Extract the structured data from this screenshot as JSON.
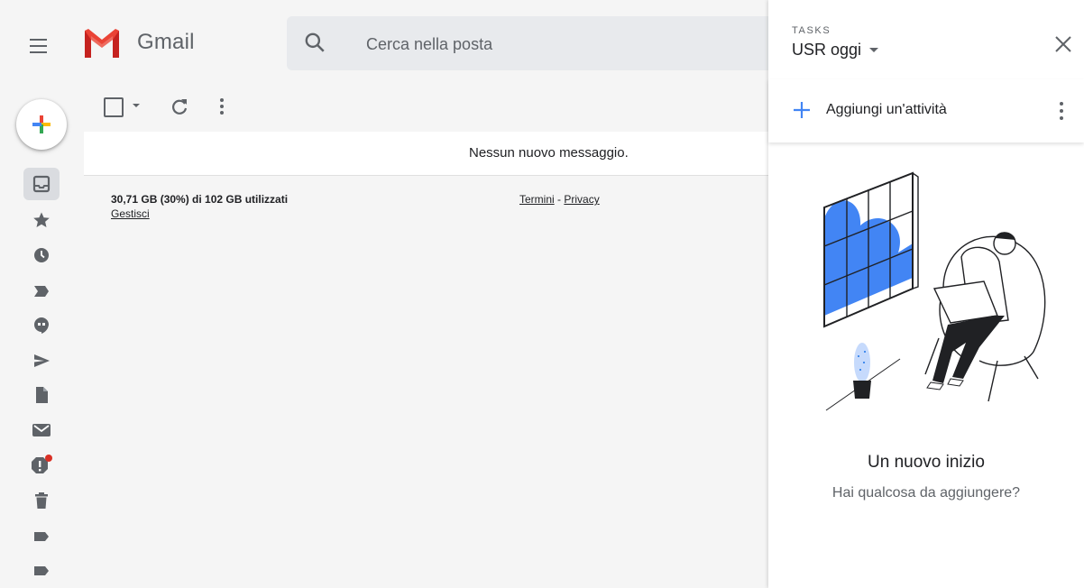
{
  "header": {
    "brand": "Gmail",
    "search_placeholder": "Cerca nella posta"
  },
  "nav": {
    "items": [
      {
        "name": "inbox-icon",
        "active": true
      },
      {
        "name": "star-icon"
      },
      {
        "name": "clock-icon"
      },
      {
        "name": "important-icon"
      },
      {
        "name": "chat-icon"
      },
      {
        "name": "send-icon"
      },
      {
        "name": "draft-icon"
      },
      {
        "name": "mail-icon"
      },
      {
        "name": "spam-icon"
      },
      {
        "name": "trash-icon"
      },
      {
        "name": "label-icon"
      },
      {
        "name": "label-icon"
      }
    ]
  },
  "mail": {
    "empty_message": "Nessun nuovo messaggio.",
    "storage": "30,71 GB (30%) di 102 GB utilizzati",
    "manage": "Gestisci",
    "terms": "Termini",
    "separator": "-",
    "privacy": "Privacy"
  },
  "tasks": {
    "label": "TASKS",
    "list_name": "USR oggi",
    "add_task": "Aggiungi un'attività",
    "empty_title": "Un nuovo inizio",
    "empty_subtitle": "Hai qualcosa da aggiungere?"
  },
  "colors": {
    "accent_blue": "#4285f4",
    "gmail_red": "#ea4335",
    "notification_dot": "#d93025"
  }
}
